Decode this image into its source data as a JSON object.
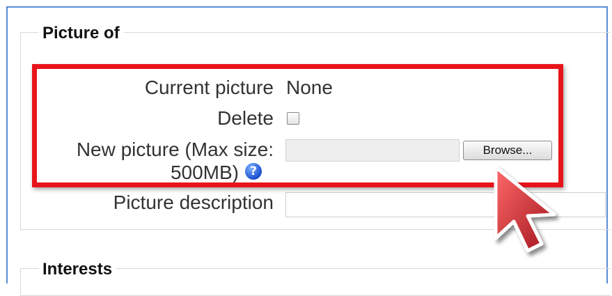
{
  "sections": {
    "picture_legend": "Picture of",
    "interests_legend": "Interests"
  },
  "picture": {
    "current_label": "Current picture",
    "current_value": "None",
    "delete_label": "Delete",
    "new_label_line1": "New picture (Max size:",
    "new_label_line2": "500MB)",
    "browse_label": "Browse...",
    "help_icon_glyph": "?",
    "description_label": "Picture description",
    "description_value": ""
  },
  "colors": {
    "highlight": "#e8141b",
    "frame": "#5b8bd6",
    "cursor_fill": "#c0212a"
  },
  "icons": [
    "help-icon",
    "mouse-cursor-icon"
  ]
}
